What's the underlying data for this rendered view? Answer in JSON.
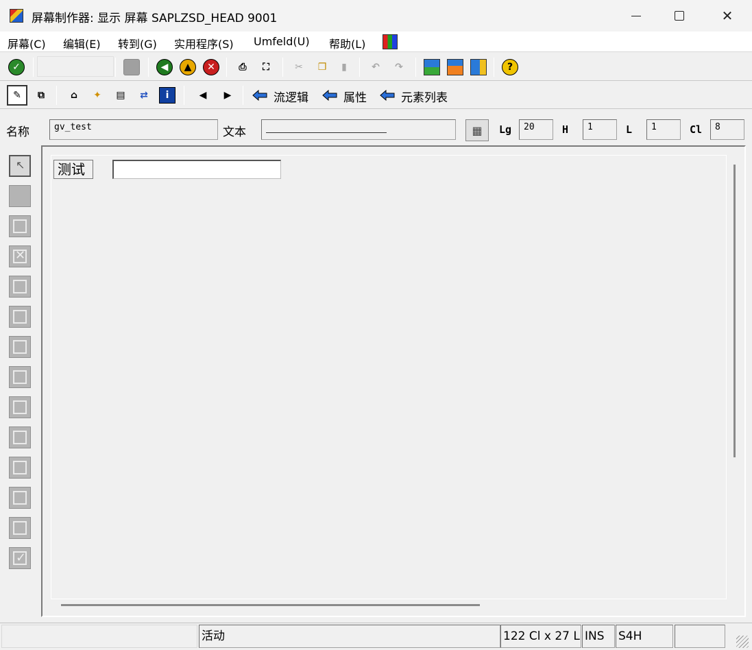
{
  "window": {
    "title": "屏幕制作器:  显示 屏幕 SAPLZSD_HEAD 9001"
  },
  "menu": [
    {
      "label": "屏幕(C)"
    },
    {
      "label": "编辑(E)"
    },
    {
      "label": "转到(G)"
    },
    {
      "label": "实用程序(S)"
    },
    {
      "label": "Umfeld(U)"
    },
    {
      "label": "帮助(L)"
    }
  ],
  "toolbar2": {
    "flow_logic": "流逻辑",
    "attributes": "属性",
    "element_list": "元素列表"
  },
  "fields": {
    "name_label": "名称",
    "name_value": "gv_test",
    "text_label": "文本",
    "lg_label": "Lg",
    "lg_value": "20",
    "h_label": "H",
    "h_value": "1",
    "l_label": "L",
    "l_value": "1",
    "cl_label": "Cl",
    "cl_value": "8"
  },
  "canvas": {
    "label_text": "测试",
    "input_value": ""
  },
  "status": {
    "mode": "活动",
    "size": "122 Cl x 27 L",
    "ins": "INS",
    "system": "S4H",
    "extra": ""
  }
}
